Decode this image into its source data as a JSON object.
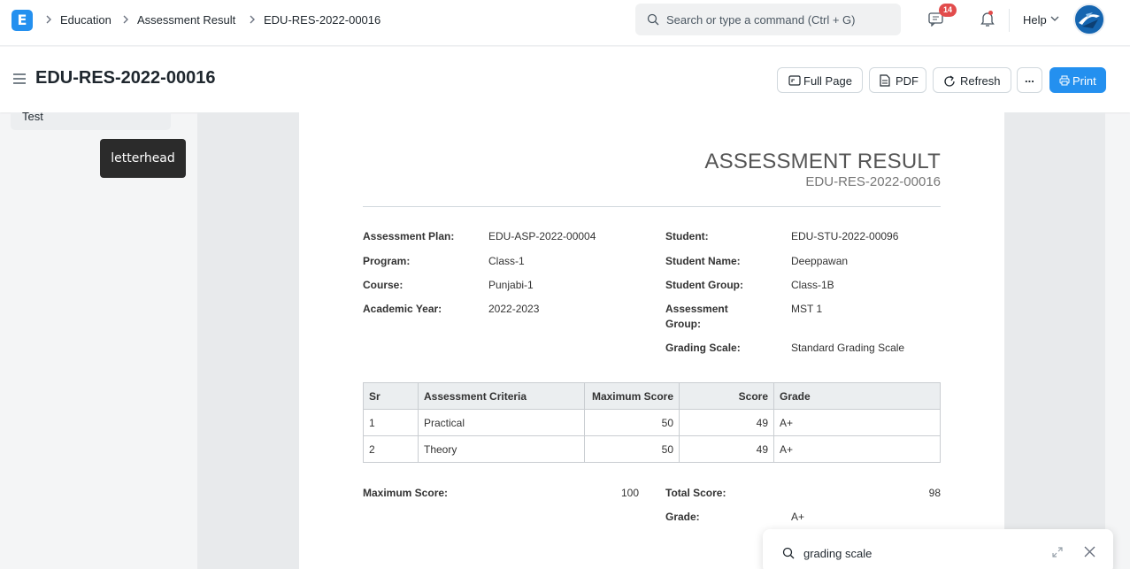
{
  "navbar": {
    "logo_letter": "E",
    "breadcrumbs": [
      "Education",
      "Assessment Result",
      "EDU-RES-2022-00016"
    ],
    "search_placeholder": "Search or type a command (Ctrl + G)",
    "notification_count": "14",
    "help_label": "Help"
  },
  "page": {
    "title": "EDU-RES-2022-00016",
    "buttons": {
      "full_page": "Full Page",
      "pdf": "PDF",
      "refresh": "Refresh",
      "more": "...",
      "print": "Print"
    }
  },
  "sidebar": {
    "selected_item": "Test",
    "tooltip": "letterhead"
  },
  "document": {
    "heading": "ASSESSMENT RESULT",
    "name": "EDU-RES-2022-00016",
    "left_fields": [
      {
        "label": "Assessment Plan:",
        "value": "EDU-ASP-2022-00004"
      },
      {
        "label": "Program:",
        "value": "Class-1"
      },
      {
        "label": "Course:",
        "value": "Punjabi-1"
      },
      {
        "label": "Academic Year:",
        "value": "2022-2023"
      }
    ],
    "right_fields": [
      {
        "label": "Student:",
        "value": "EDU-STU-2022-00096"
      },
      {
        "label": "Student Name:",
        "value": "Deeppawan"
      },
      {
        "label": "Student Group:",
        "value": "Class-1B"
      },
      {
        "label_line1": "Assessment",
        "label_line2": "Group:",
        "value": "MST 1"
      },
      {
        "label": "Grading Scale:",
        "value": "Standard Grading Scale"
      }
    ],
    "table": {
      "headers": [
        "Sr",
        "Assessment Criteria",
        "Maximum Score",
        "Score",
        "Grade"
      ],
      "rows": [
        [
          "1",
          "Practical",
          "50",
          "49",
          "A+"
        ],
        [
          "2",
          "Theory",
          "50",
          "49",
          "A+"
        ]
      ]
    },
    "totals": {
      "max_label": "Maximum Score:",
      "max_value": "100",
      "total_label": "Total Score:",
      "total_value": "98",
      "grade_label": "Grade:",
      "grade_value": "A+"
    }
  },
  "search_popup": {
    "query": "grading scale"
  },
  "colors": {
    "primary": "#2490ef",
    "badge": "#e24c4c"
  }
}
